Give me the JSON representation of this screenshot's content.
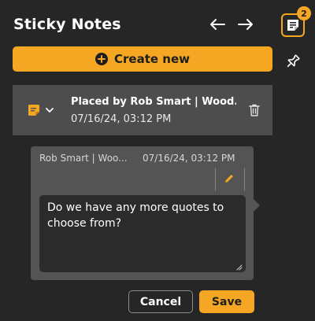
{
  "header": {
    "title": "Sticky Notes",
    "notes_count": "2",
    "prev_icon": "arrow-left-icon",
    "next_icon": "arrow-right-icon",
    "notes_icon": "sticky-note-icon"
  },
  "toolbar": {
    "create_label": "Create new",
    "create_icon": "plus-circle-icon",
    "pin_icon": "pin-icon"
  },
  "thread": {
    "author": "Placed by Rob Smart | Wood...",
    "timestamp": "07/16/24, 03:12 PM",
    "note_icon": "note-icon",
    "chevron_icon": "chevron-down-icon",
    "delete_icon": "trash-icon"
  },
  "comment": {
    "author": "Rob Smart | Woo...",
    "timestamp": "07/16/24, 03:12 PM",
    "text": "Do we have any more quotes to choose from?",
    "edit_icon": "pencil-icon"
  },
  "actions": {
    "cancel_label": "Cancel",
    "save_label": "Save"
  },
  "colors": {
    "accent": "#f5a623",
    "background": "#262626",
    "panel": "#4d4d4d",
    "card": "#545454",
    "input": "#2b2b2b"
  }
}
